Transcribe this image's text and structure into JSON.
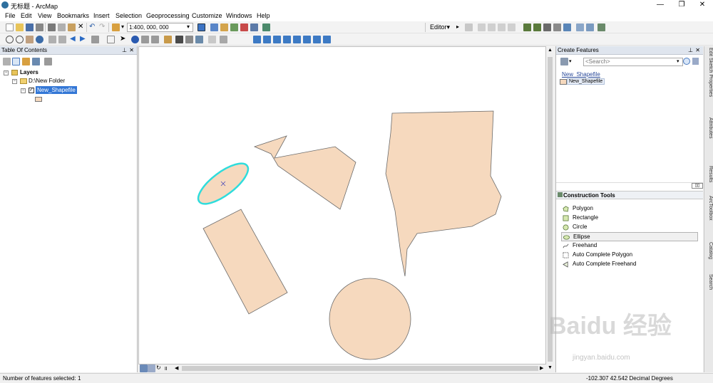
{
  "app": {
    "title": "无标题 - ArcMap"
  },
  "window_controls": {
    "minimize": "—",
    "maximize": "❐",
    "close": "✕"
  },
  "menu": [
    "File",
    "Edit",
    "View",
    "Bookmarks",
    "Insert",
    "Selection",
    "Geoprocessing",
    "Customize",
    "Windows",
    "Help"
  ],
  "toolbar": {
    "scale": "1:400, 000, 000",
    "editor_label": "Editor▾"
  },
  "toc": {
    "title": "Table Of Contents",
    "layers_label": "Layers",
    "folder_label": "D:\\New Folder",
    "layer_label": "New_Shapefile",
    "fill_color": "#f6d9be"
  },
  "create_features": {
    "title": "Create Features",
    "search_placeholder": "<Search>",
    "group_label": "New_Shapefile",
    "template_label": "New_Shapefile"
  },
  "construction_tools": {
    "title": "Construction Tools",
    "items": [
      "Polygon",
      "Rectangle",
      "Circle",
      "Ellipse",
      "Freehand",
      "Auto Complete Polygon",
      "Auto Complete Freehand"
    ],
    "selected": "Ellipse"
  },
  "dock_tabs": [
    "Edit Sketch Properties",
    "Attributes",
    "Results",
    "ArcToolbox",
    "Catalog",
    "Search"
  ],
  "status": {
    "selection": "Number of features selected: 1",
    "coords": "-102.307   42.542 Decimal Degrees"
  },
  "map": {
    "feature_fill": "#f6d9be",
    "feature_stroke": "#6b6b6b",
    "selection_color": "#2fdcdc"
  },
  "watermark": {
    "main": "Baidu 经验",
    "sub": "jingyan.baidu.com"
  }
}
